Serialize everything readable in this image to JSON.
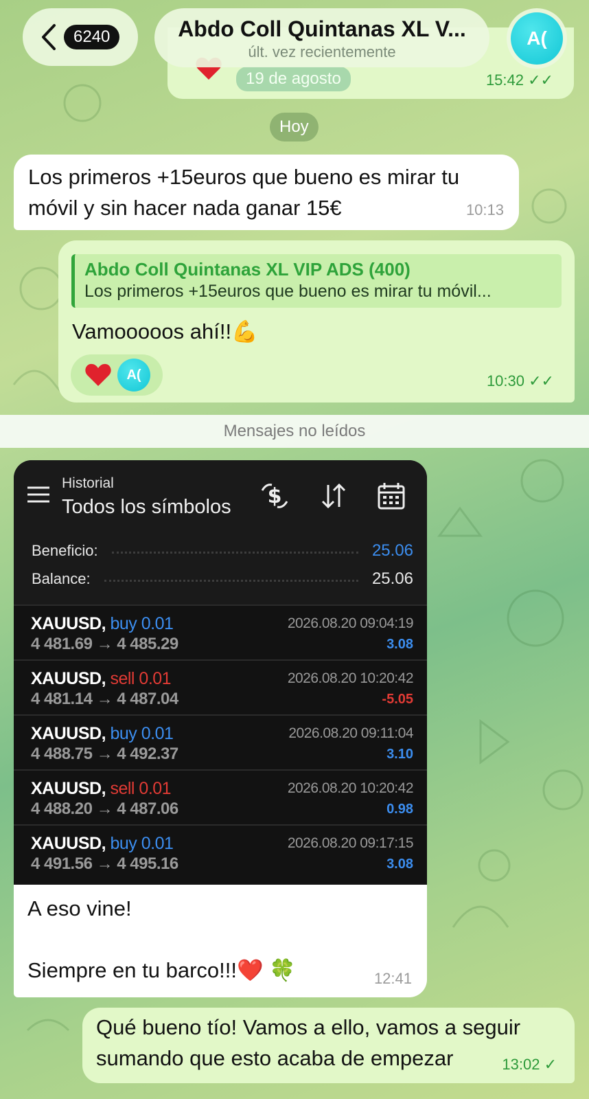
{
  "header": {
    "unread_count": "6240",
    "title": "Abdo Coll Quintanas XL V...",
    "status": "últ. vez recientemente",
    "avatar_initials": "A("
  },
  "previous_message": {
    "date_label": "19 de agosto",
    "time": "15:42"
  },
  "day_separator": "Hoy",
  "messages": [
    {
      "text": "Los primeros +15euros que bueno es mirar tu móvil y sin hacer nada ganar 15€",
      "time": "10:13"
    },
    {
      "reply_name": "Abdo Coll Quintanas XL VIP ADS (400)",
      "reply_text": "Los primeros +15euros que bueno es mirar tu móvil...",
      "text": "Vamooooos ahí!!💪",
      "reaction_initials": "A(",
      "time": "10:30"
    }
  ],
  "unread_label": "Mensajes no leídos",
  "screenshot": {
    "section_label": "Historial",
    "title": "Todos los símbolos",
    "profit_label": "Beneficio:",
    "profit_value": "25.06",
    "balance_label": "Balance:",
    "balance_value": "25.06",
    "trades": [
      {
        "symbol": "XAUUSD,",
        "side": "buy 0.01",
        "prices": "4 481.69 → 4 485.29",
        "datetime": "2026.08.20 09:04:19",
        "profit": "3.08"
      },
      {
        "symbol": "XAUUSD,",
        "side": "sell 0.01",
        "prices": "4 481.14 → 4 487.04",
        "datetime": "2026.08.20 10:20:42",
        "profit": "-5.05"
      },
      {
        "symbol": "XAUUSD,",
        "side": "buy 0.01",
        "prices": "4 488.75 → 4 492.37",
        "datetime": "2026.08.20 09:11:04",
        "profit": "3.10"
      },
      {
        "symbol": "XAUUSD,",
        "side": "sell 0.01",
        "prices": "4 488.20 → 4 487.06",
        "datetime": "2026.08.20 10:20:42",
        "profit": "0.98"
      },
      {
        "symbol": "XAUUSD,",
        "side": "buy 0.01",
        "prices": "4 491.56 → 4 495.16",
        "datetime": "2026.08.20 09:17:15",
        "profit": "3.08"
      }
    ]
  },
  "media_message": {
    "caption_line1": "A eso vine!",
    "caption_line2": "",
    "caption_line3": "Siempre en tu barco!!!❤️ 🍀",
    "time": "12:41"
  },
  "last_message": {
    "text": "Qué bueno tío! Vamos a ello, vamos a seguir sumando que esto acaba de empezar",
    "time": "13:02"
  },
  "colors": {
    "outgoing_bubble": "#e2f8c8",
    "incoming_bubble": "#ffffff",
    "accent_green": "#2ea33a",
    "buy_blue": "#3c8ef0",
    "sell_red": "#e23b35"
  }
}
